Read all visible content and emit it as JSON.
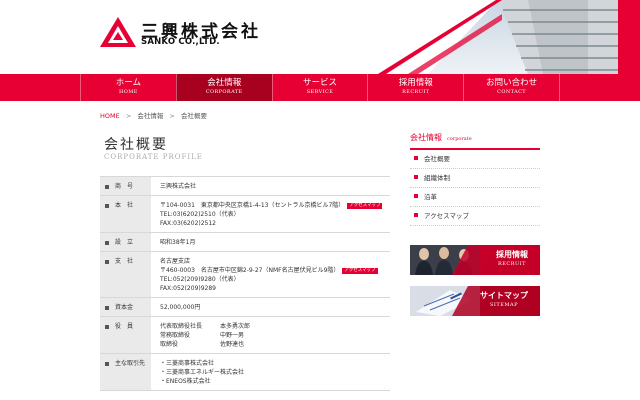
{
  "company": {
    "name_jp": "三興株式会社",
    "name_en": "SANKO CO.,LTD."
  },
  "nav": [
    {
      "jp": "ホーム",
      "en": "HOME"
    },
    {
      "jp": "会社情報",
      "en": "CORPORATE"
    },
    {
      "jp": "サービス",
      "en": "SERVICE"
    },
    {
      "jp": "採用情報",
      "en": "RECRUIT"
    },
    {
      "jp": "お問い合わせ",
      "en": "CONTACT"
    }
  ],
  "breadcrumb": {
    "home": "HOME",
    "level1": "会社情報",
    "level2": "会社概要",
    "separator": ">"
  },
  "page": {
    "title_jp": "会社概要",
    "title_en": "CORPORATE PROFILE"
  },
  "profile": {
    "map_label": "アクセスマップ",
    "company_name": {
      "label": "商　号",
      "value": "三興株式会社"
    },
    "head_office": {
      "label": "本　社",
      "address": "〒104-0031　東京都中央区京橋1-4-13（セントラル京橋ビル7階）",
      "tel": "TEL:03(6202)2510（代表）",
      "fax": "FAX:03(6202)2512"
    },
    "established": {
      "label": "設　立",
      "value": "昭和38年1月"
    },
    "branch": {
      "label": "支　社",
      "name": "名古屋支店",
      "address": "〒460-0003　名古屋市中区錦2-9-27（NMF名古屋伏見ビル9階）",
      "tel": "TEL:052(209)9280（代表）",
      "fax": "FAX:052(209)9289"
    },
    "capital": {
      "label": "資本金",
      "value": "52,000,000円"
    },
    "officers": {
      "label": "役　員",
      "list": [
        {
          "title": "代表取締役社長",
          "name": "本多勇次郎"
        },
        {
          "title": "常務取締役",
          "name": "中野一男"
        },
        {
          "title": "取締役",
          "name": "佐野達也"
        }
      ]
    },
    "clients": {
      "label": "主な取引先",
      "list": [
        "・三菱商事株式会社",
        "・三菱商事エネルギー株式会社",
        "・ENEOS株式会社"
      ]
    }
  },
  "sidebar": {
    "title_jp": "会社情報",
    "title_en": "corporate",
    "items": [
      "会社概要",
      "組織体制",
      "沿革",
      "アクセスマップ"
    ]
  },
  "banners": {
    "recruit": {
      "jp": "採用情報",
      "en": "RECRUIT"
    },
    "sitemap": {
      "jp": "サイトマップ",
      "en": "SITEMAP"
    }
  },
  "colors": {
    "brand_red": "#e60033",
    "nav_active": "#a8001f"
  },
  "icons": [
    "logo-triangle-icon",
    "square-bullet-icon"
  ]
}
